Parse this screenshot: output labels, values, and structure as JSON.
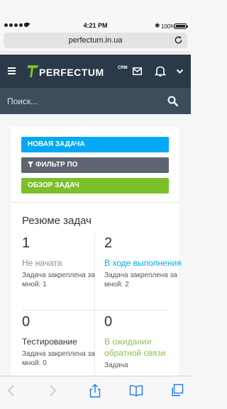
{
  "status_bar": {
    "time": "4:21 PM",
    "battery": "100%",
    "battery_level": 1.0
  },
  "browser": {
    "url": "perfectum.in.ua"
  },
  "header": {
    "brand": "PERFECTUM",
    "brand_suffix": "CRM"
  },
  "search": {
    "placeholder": "Поиск..."
  },
  "actions": {
    "new_task": "НОВАЯ ЗАДАЧА",
    "filter": "ФИЛЬТР ПО",
    "overview": "ОБЗОР ЗАДАЧ"
  },
  "summary": {
    "title": "Резюме задач",
    "items": [
      {
        "count": "1",
        "status": "Не начата",
        "assigned": "Задача закреплена за мной: 1"
      },
      {
        "count": "2",
        "status": "В ходе выполнения",
        "assigned": "Задача закреплена за мной: 2"
      },
      {
        "count": "0",
        "status": "Тестирование",
        "assigned": "Задача закреплена за мной: 0"
      },
      {
        "count": "0",
        "status": "В ожидании обратной связи",
        "assigned": "Задача"
      }
    ]
  },
  "colors": {
    "header_bg": "#2b3a48",
    "search_bg": "#3d4d5c",
    "btn_new": "#03a9f4",
    "btn_filter": "#5e6571",
    "btn_overview": "#7bc02a",
    "logo_green": "#7bc02a"
  }
}
